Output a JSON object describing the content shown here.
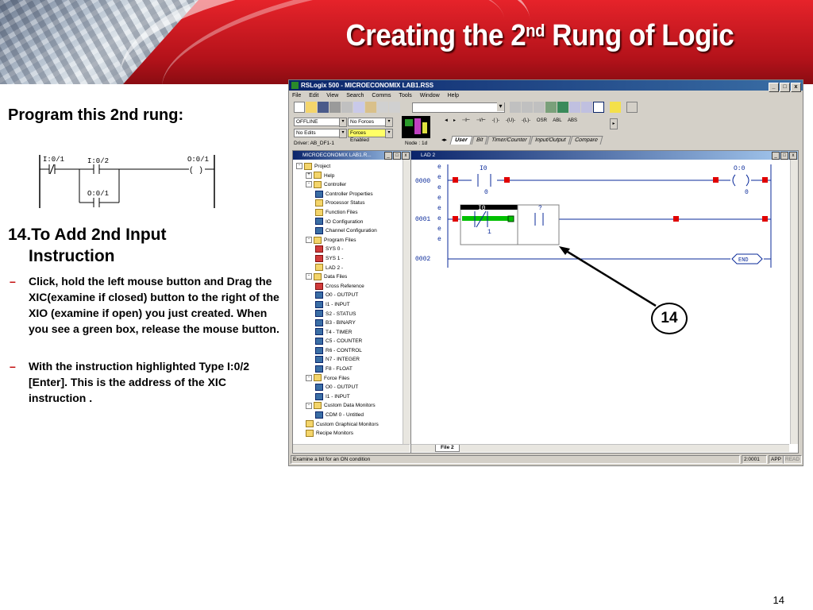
{
  "slide": {
    "title_main": "Creating the 2",
    "title_sup": "nd",
    "title_rest": " Rung of Logic",
    "subheading": "Program this 2nd rung:",
    "mini_rung": {
      "xio_addr": "I:0/1",
      "xic_addr": "I:0/2",
      "coil_addr": "O:0/1",
      "branch_addr": "O:0/1",
      "coil_symbol": "( )"
    },
    "step_title_line1": "14.To Add 2nd Input",
    "step_title_line2": "Instruction",
    "bullet1": "Click, hold the left mouse button and Drag the XIC(examine if closed) button to the right of the XIO (examine if open) you just created. When you see a green box, release the mouse button.",
    "bullet2": "With the instruction highlighted Type I:0/2 [Enter]. This is the address of the XIC instruction .",
    "bullet_marker": "–",
    "callout": "14",
    "page_number": "14"
  },
  "app": {
    "title": "RSLogix 500 - MICROECONOMIX LAB1.RSS",
    "window_buttons": [
      "_",
      "□",
      "x"
    ],
    "menu": [
      "File",
      "Edit",
      "View",
      "Search",
      "Comms",
      "Tools",
      "Window",
      "Help"
    ],
    "status_mode": "OFFLINE",
    "forces": "No Forces",
    "edits": "No Edits",
    "forces_enabled": "Forces Enabled",
    "driver": "Driver: AB_DF1-1",
    "node": "Node : 1d",
    "instruction_buttons": [
      "⊣⊢",
      "⊣/⊢",
      "-( )-",
      "-(U)-",
      "-(L)-",
      "OSR",
      "ABL",
      "ABS"
    ],
    "tabs": [
      "User",
      "Bit",
      "Timer/Counter",
      "Input/Output",
      "Compare"
    ],
    "active_tab": "User",
    "project_window_title": "MICROECONOMIX LAB1.R...",
    "ladder_window_title": "LAD 2",
    "file_tab": "File 2",
    "status_message": "Examine a bit for an ON condition",
    "status_addr": "2:0001",
    "status_app": "APP",
    "status_read": "READ",
    "tree": [
      {
        "label": "Project",
        "level": 0,
        "icon": "folder",
        "pm": "-"
      },
      {
        "label": "Help",
        "level": 1,
        "icon": "folder",
        "pm": "+"
      },
      {
        "label": "Controller",
        "level": 1,
        "icon": "folder",
        "pm": "-"
      },
      {
        "label": "Controller Properties",
        "level": 2,
        "icon": "blue"
      },
      {
        "label": "Processor Status",
        "level": 2,
        "icon": "folder"
      },
      {
        "label": "Function Files",
        "level": 2,
        "icon": "folder"
      },
      {
        "label": "IO Configuration",
        "level": 2,
        "icon": "blue"
      },
      {
        "label": "Channel Configuration",
        "level": 2,
        "icon": "blue"
      },
      {
        "label": "Program Files",
        "level": 1,
        "icon": "folder",
        "pm": "-"
      },
      {
        "label": "SYS 0 -",
        "level": 2,
        "icon": "red"
      },
      {
        "label": "SYS 1 -",
        "level": 2,
        "icon": "red"
      },
      {
        "label": "LAD 2 -",
        "level": 2,
        "icon": "folder"
      },
      {
        "label": "Data Files",
        "level": 1,
        "icon": "folder",
        "pm": "-"
      },
      {
        "label": "Cross Reference",
        "level": 2,
        "icon": "red"
      },
      {
        "label": "O0 - OUTPUT",
        "level": 2,
        "icon": "blue"
      },
      {
        "label": "I1 - INPUT",
        "level": 2,
        "icon": "blue"
      },
      {
        "label": "S2 - STATUS",
        "level": 2,
        "icon": "blue"
      },
      {
        "label": "B3 - BINARY",
        "level": 2,
        "icon": "blue"
      },
      {
        "label": "T4 - TIMER",
        "level": 2,
        "icon": "blue"
      },
      {
        "label": "C5 - COUNTER",
        "level": 2,
        "icon": "blue"
      },
      {
        "label": "R6 - CONTROL",
        "level": 2,
        "icon": "blue"
      },
      {
        "label": "N7 - INTEGER",
        "level": 2,
        "icon": "blue"
      },
      {
        "label": "F8 - FLOAT",
        "level": 2,
        "icon": "blue"
      },
      {
        "label": "Force Files",
        "level": 1,
        "icon": "folder",
        "pm": "-"
      },
      {
        "label": "O0 - OUTPUT",
        "level": 2,
        "icon": "blue"
      },
      {
        "label": "I1 - INPUT",
        "level": 2,
        "icon": "blue"
      },
      {
        "label": "Custom Data Monitors",
        "level": 1,
        "icon": "folder",
        "pm": "-"
      },
      {
        "label": "CDM 0 - Untitled",
        "level": 2,
        "icon": "blue"
      },
      {
        "label": "Custom Graphical Monitors",
        "level": 1,
        "icon": "folder"
      },
      {
        "label": "Recipe Monitors",
        "level": 1,
        "icon": "folder"
      }
    ],
    "ladder": {
      "rungs": [
        "0000",
        "0001",
        "0002"
      ],
      "rung_edit_mark": "e",
      "rung0_contact_addr": "I0",
      "rung0_contact_bit": "0",
      "rung0_coil_addr": "O:0",
      "rung0_coil_bit": "0",
      "rung1_xio_addr": "I0",
      "rung1_xio_bit": "1",
      "rung1_new_addr": "?",
      "end_label": "END"
    },
    "colors": {
      "title_bar": "#0a246a",
      "drop_target": "#00c000",
      "edit_marker": "#e00000",
      "slide_red": "#c8161d"
    }
  }
}
